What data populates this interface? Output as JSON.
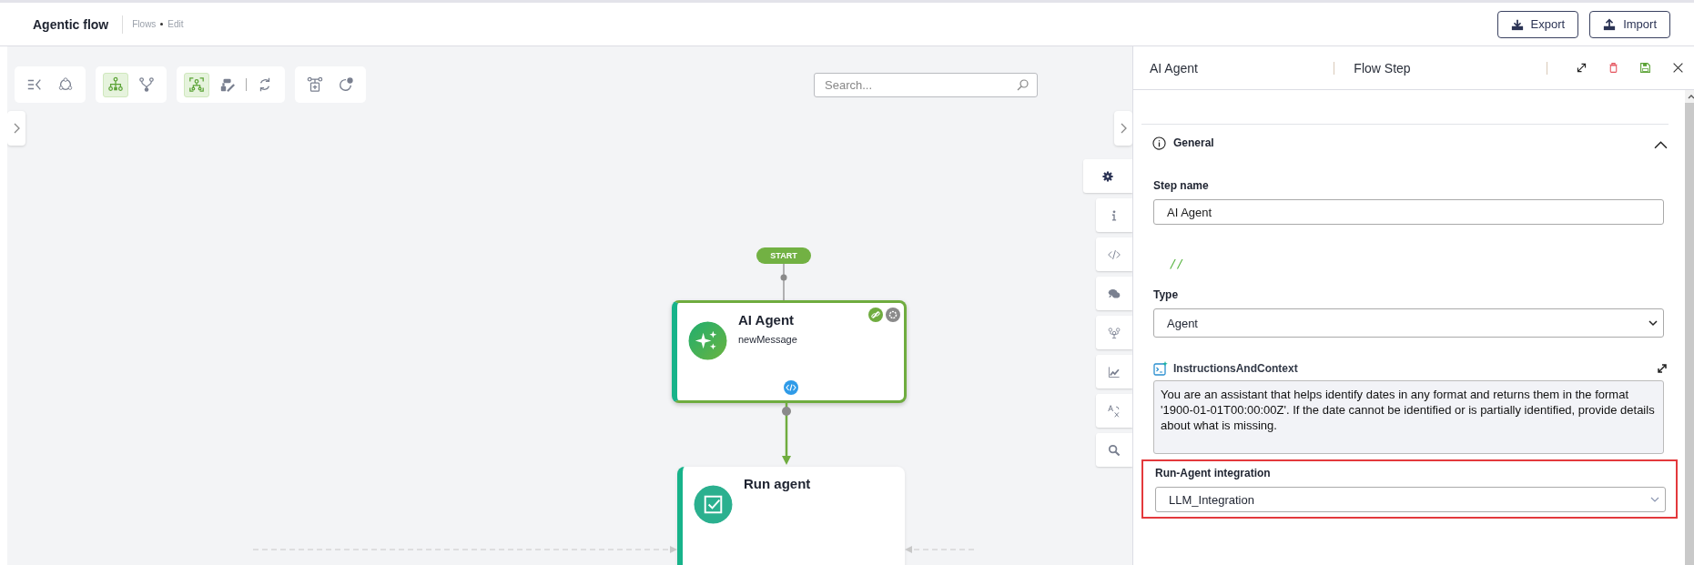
{
  "header": {
    "title": "Agentic flow",
    "breadcrumb": [
      "Flows",
      "Edit"
    ],
    "buttons": [
      {
        "kind": "export",
        "label": "Export"
      },
      {
        "kind": "import",
        "label": "Import"
      }
    ]
  },
  "toolbar": [
    {
      "tools": [
        {
          "kind": "list-collapse",
          "selected": false
        },
        {
          "kind": "cycle",
          "selected": false
        }
      ]
    },
    {
      "tools": [
        {
          "kind": "hierarchy",
          "selected": true
        },
        {
          "kind": "branch",
          "selected": false
        }
      ]
    },
    {
      "tools": [
        {
          "kind": "focus",
          "selected": true
        },
        {
          "kind": "edit-node",
          "selected": false
        },
        {
          "kind": "refresh",
          "selected": false
        }
      ]
    },
    {
      "tools": [
        {
          "kind": "add-node",
          "selected": false
        },
        {
          "kind": "circle-dot",
          "selected": false
        }
      ]
    }
  ],
  "search": {
    "placeholder": "Search..."
  },
  "side_tabs": [
    {
      "kind": "settings",
      "selected": true
    },
    {
      "kind": "info",
      "selected": false
    },
    {
      "kind": "code",
      "selected": false
    },
    {
      "kind": "chat",
      "selected": false
    },
    {
      "kind": "people",
      "selected": false
    },
    {
      "kind": "chart",
      "selected": false
    },
    {
      "kind": "translate",
      "selected": false
    },
    {
      "kind": "search",
      "selected": false
    }
  ],
  "flow": {
    "start": "START",
    "nodes": [
      {
        "kind": "agent",
        "title": "AI Agent",
        "subtitle": "newMessage",
        "selected": true
      },
      {
        "kind": "run",
        "title": "Run agent",
        "selected": false
      }
    ]
  },
  "panel": {
    "title": "AI Agent",
    "subtitle": "Flow Step",
    "section": {
      "title": "General",
      "expanded": true
    },
    "step_name": {
      "label": "Step name",
      "value": "AI Agent"
    },
    "code": "//",
    "type": {
      "label": "Type",
      "value": "Agent"
    },
    "instructions": {
      "label": "InstructionsAndContext",
      "value": "You are an assistant that helps identify dates in any format and returns them in the format '1900-01-01T00:00:00Z'. If the date cannot be identified or is partially identified, provide details about what is missing."
    },
    "integration": {
      "label": "Run-Agent integration",
      "value": "LLM_Integration",
      "highlighted": true
    }
  }
}
